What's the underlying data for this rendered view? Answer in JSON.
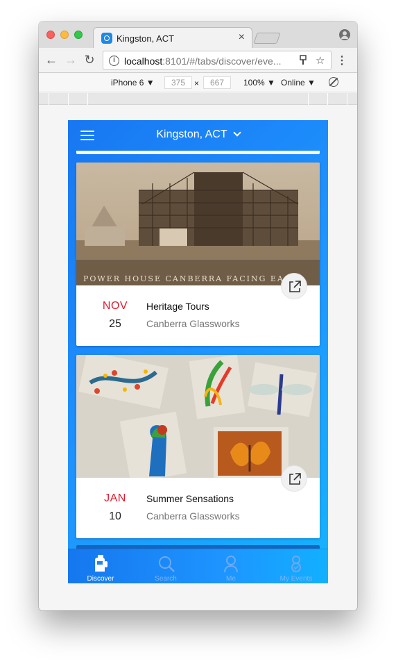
{
  "browser": {
    "tab_title": "Kingston, ACT",
    "tab_close": "×",
    "url_host": "localhost",
    "url_rest": ":8101/#/tabs/discover/eve...",
    "device": "iPhone 6 ▼",
    "width": "375",
    "times": "×",
    "height": "667",
    "zoom": "100% ▼",
    "network": "Online ▼",
    "back": "←",
    "forward": "→",
    "reload": "↻",
    "info": "i",
    "bookmark": "☆",
    "menu": "⋮"
  },
  "app": {
    "title": "Kingston, ACT",
    "events": [
      {
        "month": "NOV",
        "day": "25",
        "title": "Heritage Tours",
        "venue": "Canberra Glassworks"
      },
      {
        "month": "JAN",
        "day": "10",
        "title": "Summer Sensations",
        "venue": "Canberra Glassworks"
      }
    ],
    "tabs": [
      {
        "label": "Discover",
        "icon": "discover-icon",
        "active": true
      },
      {
        "label": "Search",
        "icon": "search-icon",
        "active": false
      },
      {
        "label": "Me",
        "icon": "user-icon",
        "active": false
      },
      {
        "label": "My Events",
        "icon": "events-icon",
        "active": false
      }
    ]
  },
  "colors": {
    "accent": "#1e88e5",
    "date_red": "#e21b2e"
  }
}
